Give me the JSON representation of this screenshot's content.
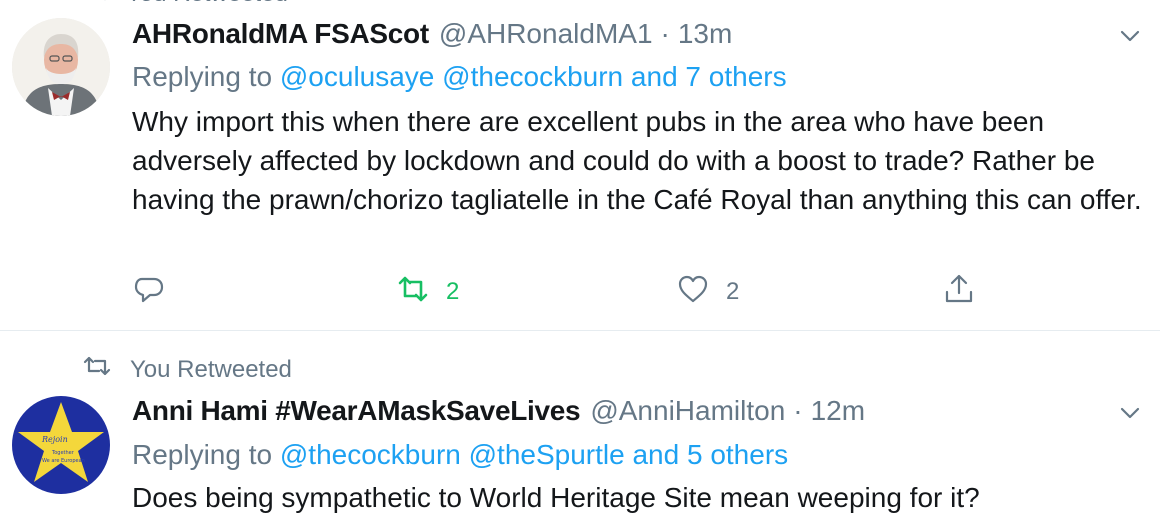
{
  "retweet_notice": "You Retweeted",
  "tweets": [
    {
      "name": "AHRonaldMA FSAScot",
      "handle": "@AHRonaldMA1",
      "separator": "·",
      "time": "13m",
      "replying_prefix": "Replying to",
      "mention_1": "@oculusaye",
      "mention_2": "@thecockburn",
      "others": "and 7 others",
      "body": "Why import this when there are excellent pubs in the area who have been adversely affected by lockdown and could do with a boost to trade? Rather be having the prawn/chorizo tagliatelle in the Café Royal than anything this can offer.",
      "retweet_count": "2",
      "like_count": "2"
    },
    {
      "retweeted_label": "You Retweeted",
      "name": "Anni Hami #WearAMaskSaveLives",
      "handle": "@AnniHamilton",
      "separator": "·",
      "time": "12m",
      "replying_prefix": "Replying to",
      "mention_1": "@thecockburn",
      "mention_2": "@theSpurtle",
      "others": "and 5 others",
      "body": "Does being sympathetic to World Heritage Site mean weeping for it?"
    }
  ],
  "icons": {
    "reply": "reply-icon",
    "retweet": "retweet-icon",
    "like": "heart-icon",
    "share": "share-icon",
    "more": "chevron-down-icon"
  },
  "colors": {
    "accent": "#1da1f2",
    "retweet_active": "#17bf63",
    "secondary_text": "#657786",
    "divider": "#e6ecf0"
  }
}
